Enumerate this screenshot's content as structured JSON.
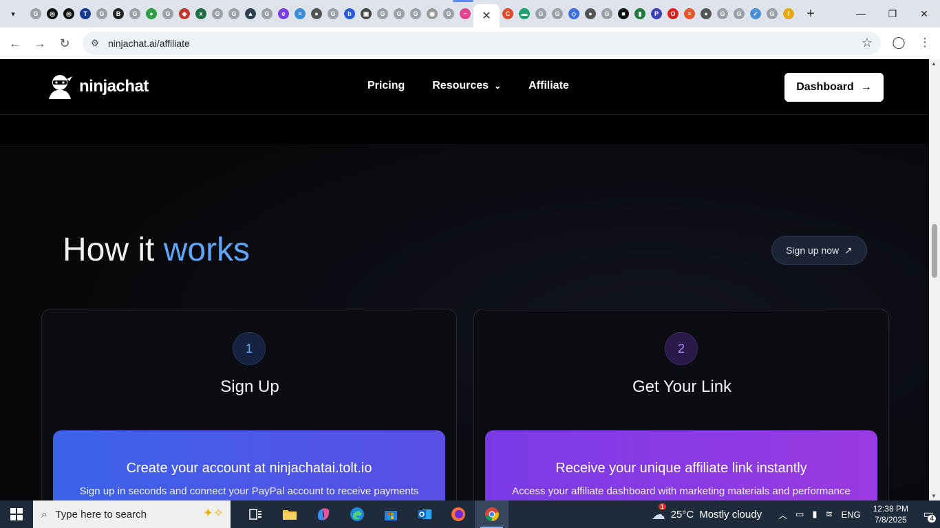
{
  "browser": {
    "tab_search_icon": "chevron-down-icon",
    "active_tab_close": "✕",
    "new_tab": "+",
    "window_controls": [
      "—",
      "❐",
      "✕"
    ],
    "url": "ninjachat.ai/affiliate",
    "favicons": [
      {
        "glyph": "G",
        "color": "#9aa0a6"
      },
      {
        "glyph": "◎",
        "color": "#111111"
      },
      {
        "glyph": "◎",
        "color": "#111111"
      },
      {
        "glyph": "T",
        "color": "#1a3a8f"
      },
      {
        "glyph": "G",
        "color": "#9aa0a6"
      },
      {
        "glyph": "B",
        "color": "#222222"
      },
      {
        "glyph": "G",
        "color": "#9aa0a6"
      },
      {
        "glyph": "●",
        "color": "#2e9e44"
      },
      {
        "glyph": "G",
        "color": "#9aa0a6"
      },
      {
        "glyph": "◆",
        "color": "#c0392b"
      },
      {
        "glyph": "x",
        "color": "#1d6f42"
      },
      {
        "glyph": "G",
        "color": "#9aa0a6"
      },
      {
        "glyph": "G",
        "color": "#9aa0a6"
      },
      {
        "glyph": "▲",
        "color": "#2c3e50"
      },
      {
        "glyph": "G",
        "color": "#9aa0a6"
      },
      {
        "glyph": "e",
        "color": "#7b3fe4"
      },
      {
        "glyph": "≈",
        "color": "#3a8ed6"
      },
      {
        "glyph": "●",
        "color": "#555555"
      },
      {
        "glyph": "G",
        "color": "#9aa0a6"
      },
      {
        "glyph": "b",
        "color": "#2a5bd7"
      },
      {
        "glyph": "▣",
        "color": "#444444"
      },
      {
        "glyph": "G",
        "color": "#9aa0a6"
      },
      {
        "glyph": "G",
        "color": "#9aa0a6"
      },
      {
        "glyph": "G",
        "color": "#9aa0a6"
      },
      {
        "glyph": "◉",
        "color": "#999999"
      },
      {
        "glyph": "G",
        "color": "#9aa0a6"
      },
      {
        "glyph": "~",
        "color": "#e0468c"
      }
    ],
    "favicons_after": [
      {
        "glyph": "C",
        "color": "#e24a2b"
      },
      {
        "glyph": "▬",
        "color": "#1aa36f"
      },
      {
        "glyph": "G",
        "color": "#9aa0a6"
      },
      {
        "glyph": "G",
        "color": "#9aa0a6"
      },
      {
        "glyph": "◇",
        "color": "#3b6fe0"
      },
      {
        "glyph": "●",
        "color": "#555555"
      },
      {
        "glyph": "G",
        "color": "#9aa0a6"
      },
      {
        "glyph": "■",
        "color": "#111111"
      },
      {
        "glyph": "▮",
        "color": "#1f7a3a"
      },
      {
        "glyph": "P",
        "color": "#3b3fb8"
      },
      {
        "glyph": "O",
        "color": "#e02020"
      },
      {
        "glyph": "≡",
        "color": "#e8552b"
      },
      {
        "glyph": "●",
        "color": "#555555"
      },
      {
        "glyph": "G",
        "color": "#9aa0a6"
      },
      {
        "glyph": "G",
        "color": "#9aa0a6"
      },
      {
        "glyph": "✓",
        "color": "#4a90d9"
      },
      {
        "glyph": "G",
        "color": "#9aa0a6"
      },
      {
        "glyph": "!",
        "color": "#e6a817"
      }
    ]
  },
  "site": {
    "logo_text": "ninjachat",
    "nav": {
      "pricing": "Pricing",
      "resources": "Resources",
      "affiliate": "Affiliate"
    },
    "dashboard_label": "Dashboard",
    "dashboard_arrow": "→"
  },
  "section": {
    "heading_plain": "How it ",
    "heading_accent": "works",
    "signup_label": "Sign up now",
    "signup_icon": "↗",
    "accent_color": "#60a5fa"
  },
  "steps": [
    {
      "number": "1",
      "title": "Sign Up",
      "panel_title": "Create your account at ninjachatai.tolt.io",
      "panel_text": "Sign up in seconds and connect your PayPal account to receive payments"
    },
    {
      "number": "2",
      "title": "Get Your Link",
      "panel_title": "Receive your unique affiliate link instantly",
      "panel_text": "Access your affiliate dashboard with marketing materials and performance"
    }
  ],
  "taskbar": {
    "search_placeholder": "Type here to search",
    "weather_temp": "25°C",
    "weather_text": "Mostly cloudy",
    "weather_badge": "1",
    "language": "ENG",
    "time": "12:38 PM",
    "date": "7/8/2025",
    "notification_count": "4"
  }
}
